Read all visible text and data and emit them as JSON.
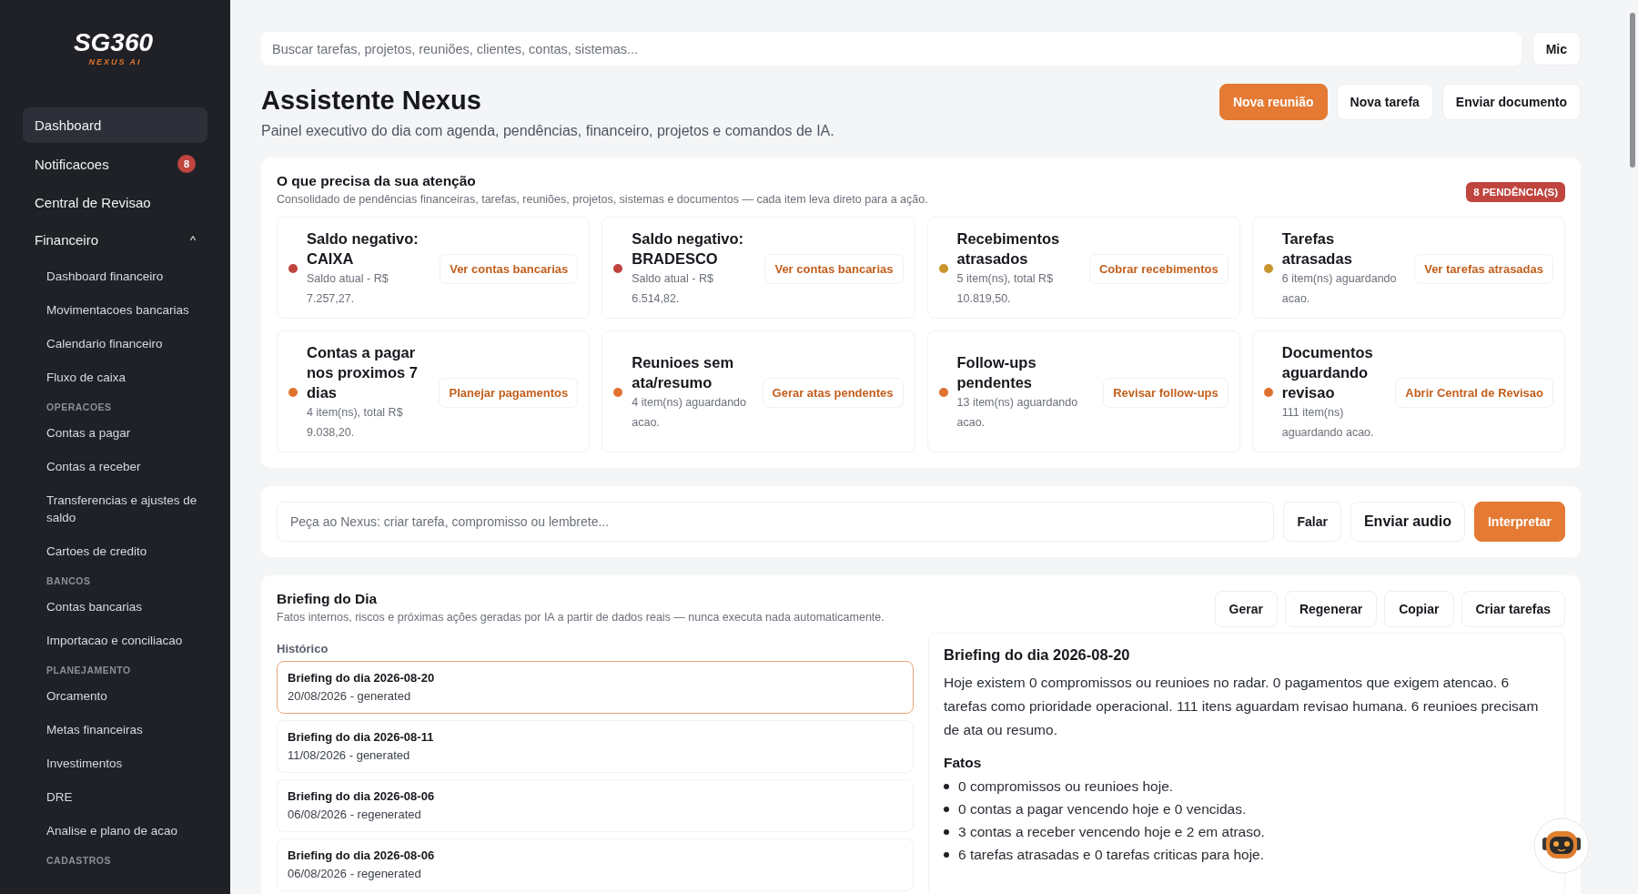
{
  "logo": {
    "main": "SG360",
    "sub": "NEXUS AI"
  },
  "sidebar": {
    "items": [
      {
        "kind": "item",
        "label": "Dashboard",
        "selected": true
      },
      {
        "kind": "item",
        "label": "Notificacoes",
        "selected": false,
        "badge": "8"
      },
      {
        "kind": "item",
        "label": "Central de Revisao",
        "selected": false
      },
      {
        "kind": "group",
        "label": "Financeiro",
        "selected": false,
        "expanded": true,
        "caret": "^"
      },
      {
        "kind": "sub",
        "label": "Dashboard financeiro",
        "selected": false
      },
      {
        "kind": "sub",
        "label": "Movimentacoes bancarias",
        "selected": false
      },
      {
        "kind": "sub",
        "label": "Calendario financeiro",
        "selected": false
      },
      {
        "kind": "sub",
        "label": "Fluxo de caixa",
        "selected": false
      },
      {
        "kind": "section",
        "label": "OPERACOES"
      },
      {
        "kind": "sub",
        "label": "Contas a pagar",
        "selected": false
      },
      {
        "kind": "sub",
        "label": "Contas a receber",
        "selected": false
      },
      {
        "kind": "sub",
        "label": "Transferencias e ajustes de saldo",
        "selected": false
      },
      {
        "kind": "sub",
        "label": "Cartoes de credito",
        "selected": false
      },
      {
        "kind": "section",
        "label": "BANCOS"
      },
      {
        "kind": "sub",
        "label": "Contas bancarias",
        "selected": false
      },
      {
        "kind": "sub",
        "label": "Importacao e conciliacao",
        "selected": false
      },
      {
        "kind": "section",
        "label": "PLANEJAMENTO"
      },
      {
        "kind": "sub",
        "label": "Orcamento",
        "selected": false
      },
      {
        "kind": "sub",
        "label": "Metas financeiras",
        "selected": false
      },
      {
        "kind": "sub",
        "label": "Investimentos",
        "selected": false
      },
      {
        "kind": "sub",
        "label": "DRE",
        "selected": false
      },
      {
        "kind": "sub",
        "label": "Analise e plano de acao",
        "selected": false
      },
      {
        "kind": "section",
        "label": "CADASTROS"
      }
    ]
  },
  "search": {
    "placeholder": "Buscar tarefas, projetos, reuniões, clientes, contas, sistemas...",
    "mic": "Mic"
  },
  "header": {
    "title": "Assistente Nexus",
    "subtitle": "Painel executivo do dia com agenda, pendências, financeiro, projetos e comandos de IA.",
    "buttons": [
      {
        "label": "Nova reunião",
        "kind": "primary"
      },
      {
        "label": "Nova tarefa",
        "kind": "plain"
      },
      {
        "label": "Enviar documento",
        "kind": "plain"
      }
    ]
  },
  "attention": {
    "title": "O que precisa da sua atenção",
    "subtitle": "Consolidado de pendências financeiras, tarefas, reuniões, projetos, sistemas e documentos — cada item leva direto para a ação.",
    "badge": "8 PENDÊNCIA(S)",
    "items": [
      {
        "title": "Saldo negativo: CAIXA",
        "detail": "Saldo atual - R$ 7.257,27.",
        "action": "Ver contas bancarias",
        "color": "#c0453f"
      },
      {
        "title": "Saldo negativo: BRADESCO",
        "detail": "Saldo atual - R$ 6.514,82.",
        "action": "Ver contas bancarias",
        "color": "#c0453f"
      },
      {
        "title": "Recebimentos atrasados",
        "detail": "5 item(ns), total R$ 10.819,50.",
        "action": "Cobrar recebimentos",
        "color": "#c9962e"
      },
      {
        "title": "Tarefas atrasadas",
        "detail": "6 item(ns) aguardando acao.",
        "action": "Ver tarefas atrasadas",
        "color": "#c9962e"
      },
      {
        "title": "Contas a pagar nos proximos 7 dias",
        "detail": "4 item(ns), total R$ 9.038,20.",
        "action": "Planejar pagamentos",
        "color": "#e0722f"
      },
      {
        "title": "Reunioes sem ata/resumo",
        "detail": "4 item(ns) aguardando acao.",
        "action": "Gerar atas pendentes",
        "color": "#e0722f"
      },
      {
        "title": "Follow-ups pendentes",
        "detail": "13 item(ns) aguardando acao.",
        "action": "Revisar follow-ups",
        "color": "#e0722f"
      },
      {
        "title": "Documentos aguardando revisao",
        "detail": "111 item(ns) aguardando acao.",
        "action": "Abrir Central de Revisao",
        "color": "#e0722f"
      }
    ]
  },
  "command": {
    "placeholder": "Peça ao Nexus: criar tarefa, compromisso ou lembrete...",
    "buttons": [
      {
        "label": "Falar",
        "kind": "plain"
      },
      {
        "label": "Enviar audio",
        "kind": "large"
      },
      {
        "label": "Interpretar",
        "kind": "primary"
      }
    ]
  },
  "briefing": {
    "title": "Briefing do Dia",
    "subtitle": "Fatos internos, riscos e próximas ações geradas por IA a partir de dados reais — nunca executa nada automaticamente.",
    "buttons": [
      "Gerar",
      "Regenerar",
      "Copiar",
      "Criar tarefas"
    ],
    "history_label": "Histórico",
    "history": [
      {
        "title": "Briefing do dia 2026-08-20",
        "meta": "20/08/2026 - generated",
        "selected": true
      },
      {
        "title": "Briefing do dia 2026-08-11",
        "meta": "11/08/2026 - generated",
        "selected": false
      },
      {
        "title": "Briefing do dia 2026-08-06",
        "meta": "06/08/2026 - regenerated",
        "selected": false
      },
      {
        "title": "Briefing do dia 2026-08-06",
        "meta": "06/08/2026 - regenerated",
        "selected": false
      }
    ],
    "detail": {
      "title": "Briefing do dia 2026-08-20",
      "summary": "Hoje existem 0 compromissos ou reunioes no radar. 0 pagamentos que exigem atencao. 6 tarefas como prioridade operacional. 111 itens aguardam revisao humana. 6 reunioes precisam de ata ou resumo.",
      "facts_title": "Fatos",
      "facts": [
        "0 compromissos ou reunioes hoje.",
        "0 contas a pagar vencendo hoje e 0 vencidas.",
        "3 contas a receber vencendo hoje e 2 em atraso.",
        "6 tarefas atrasadas e 0 tarefas criticas para hoje."
      ]
    }
  }
}
